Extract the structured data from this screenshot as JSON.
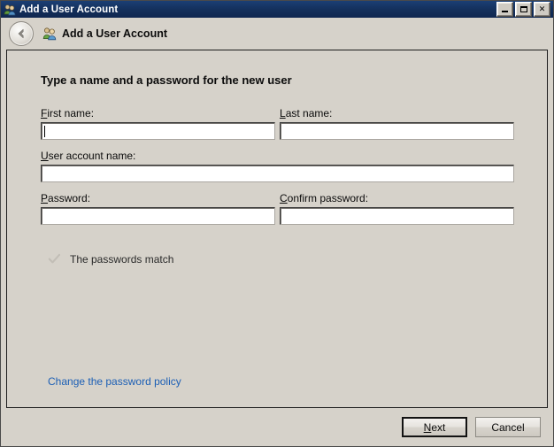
{
  "window": {
    "title": "Add a User Account",
    "icon": "users-icon",
    "buttons": {
      "minimize": "minimize-button",
      "maximize": "maximize-button",
      "close": "close-button",
      "close_glyph": "✕"
    }
  },
  "header": {
    "back_label": "Back",
    "icon": "users-icon",
    "title": "Add a User Account"
  },
  "content": {
    "instruction": "Type a name and a password for the new user",
    "fields": {
      "first_name": {
        "label_pre": "",
        "label_accel": "F",
        "label_post": "irst name:",
        "value": "",
        "placeholder": ""
      },
      "last_name": {
        "label_pre": "",
        "label_accel": "L",
        "label_post": "ast name:",
        "value": "",
        "placeholder": ""
      },
      "user_account_name": {
        "label_pre": "",
        "label_accel": "U",
        "label_post": "ser account name:",
        "value": "",
        "placeholder": ""
      },
      "password": {
        "label_pre": "",
        "label_accel": "P",
        "label_post": "assword:",
        "value": "",
        "placeholder": ""
      },
      "confirm_password": {
        "label_pre": "",
        "label_accel": "C",
        "label_post": "onfirm password:",
        "value": "",
        "placeholder": ""
      }
    },
    "password_match": {
      "icon": "check-icon",
      "text": "The passwords match"
    },
    "policy_link": "Change the password policy"
  },
  "footer": {
    "next_accel": "N",
    "next_post": "ext",
    "cancel": "Cancel"
  },
  "colors": {
    "titlebar": "#14305c",
    "window_bg": "#d6d2ca",
    "link": "#1c5fb5",
    "check_disabled": "#c2beb6",
    "field_bg": "#ffffff"
  }
}
